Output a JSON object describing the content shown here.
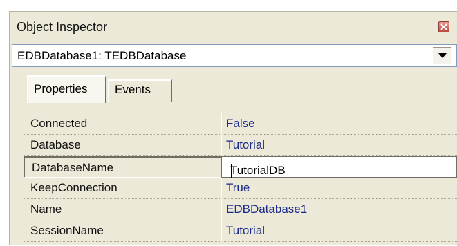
{
  "window": {
    "title": "Object Inspector"
  },
  "component_selector": {
    "value": "EDBDatabase1: TEDBDatabase"
  },
  "tabs": [
    {
      "label": "Properties",
      "active": true
    },
    {
      "label": "Events",
      "active": false
    }
  ],
  "properties": [
    {
      "name": "Connected",
      "value": "False"
    },
    {
      "name": "Database",
      "value": "Tutorial"
    },
    {
      "name": "DatabaseName",
      "value": "TutorialDB",
      "editing": true
    },
    {
      "name": "KeepConnection",
      "value": "True"
    },
    {
      "name": "Name",
      "value": "EDBDatabase1"
    },
    {
      "name": "SessionName",
      "value": "Tutorial"
    }
  ],
  "colors": {
    "panel_background": "#ece9d8",
    "value_text": "#1a2a8a",
    "close_button": "#c04a40"
  },
  "icons": {
    "close": "close-icon",
    "dropdown": "chevron-down-icon"
  }
}
